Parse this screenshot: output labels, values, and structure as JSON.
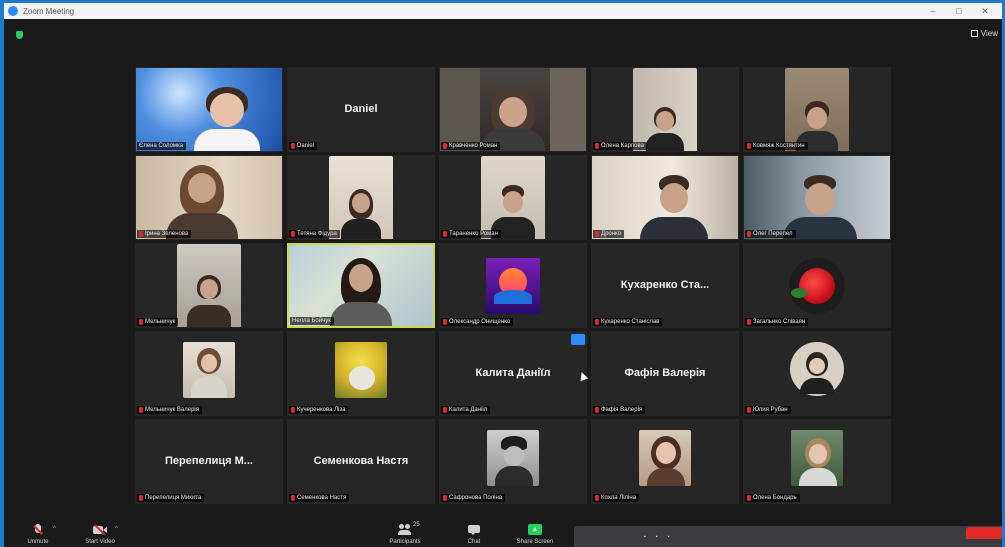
{
  "app": {
    "title": "Zoom Meeting",
    "view_label": "View"
  },
  "window_controls": [
    "–",
    "□",
    "✕"
  ],
  "participants": [
    {
      "name": "Єлена Соломка",
      "display": "",
      "has_video": true
    },
    {
      "name": "Daniel",
      "display": "Daniel",
      "has_video": false
    },
    {
      "name": "Кравченко Роман",
      "display": "",
      "has_video": true
    },
    {
      "name": "Олена Карпова",
      "display": "",
      "has_video": true
    },
    {
      "name": "Ковмяж Костянтин",
      "display": "",
      "has_video": true
    },
    {
      "name": "Ірина Зеленова",
      "display": "",
      "has_video": true
    },
    {
      "name": "Тетяна Фідура",
      "display": "",
      "has_video": true
    },
    {
      "name": "Тараненко Роман",
      "display": "",
      "has_video": true
    },
    {
      "name": "Дронко",
      "display": "",
      "has_video": true
    },
    {
      "name": "Олег Перепел",
      "display": "",
      "has_video": true
    },
    {
      "name": "Мельничук",
      "display": "",
      "has_video": true
    },
    {
      "name": "Нелла Бойчук",
      "display": "",
      "has_video": true,
      "active": true
    },
    {
      "name": "Олександр Онищенко",
      "display": "",
      "has_video": true
    },
    {
      "name": "Кухаренко Станіслав",
      "display": "Кухаренко Ста...",
      "has_video": false
    },
    {
      "name": "Загальнко Сліваян",
      "display": "",
      "has_video": true
    },
    {
      "name": "Мельничук Валерія",
      "display": "",
      "has_video": true
    },
    {
      "name": "Кучеренкова Ліза",
      "display": "",
      "has_video": true
    },
    {
      "name": "Калита Данііл",
      "display": "Калита Даніїл",
      "has_video": false
    },
    {
      "name": "Фафія Валерія",
      "display": "Фафія Валерія",
      "has_video": false
    },
    {
      "name": "Юлия Рубан",
      "display": "",
      "has_video": true
    },
    {
      "name": "Перепелиця Микита",
      "display": "Перепелиця М...",
      "has_video": false
    },
    {
      "name": "Семенкова Настя",
      "display": "Семенкова Настя",
      "has_video": false
    },
    {
      "name": "Сафронова Поліна",
      "display": "",
      "has_video": true
    },
    {
      "name": "Кохла Ліліна",
      "display": "",
      "has_video": true
    },
    {
      "name": "Олена Бондарь",
      "display": "",
      "has_video": true
    }
  ],
  "toolbar": {
    "unmute": "Unmute",
    "start_video": "Start Video",
    "participants": "Participants",
    "participants_count": "25",
    "chat": "Chat",
    "share_screen": "Share Screen"
  },
  "colors": {
    "accent": "#2d8cff",
    "active_speaker": "#c7d94a",
    "mute": "#e02a2a",
    "share": "#23d160"
  }
}
